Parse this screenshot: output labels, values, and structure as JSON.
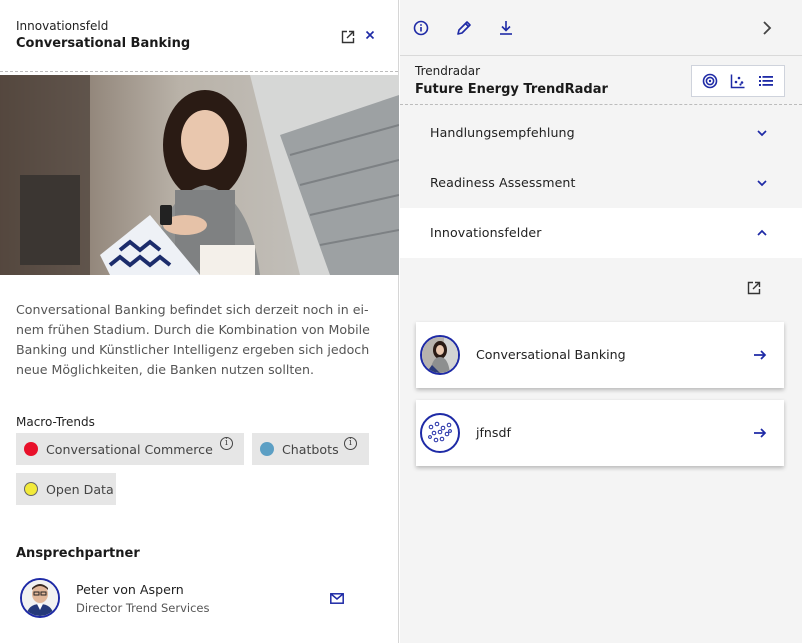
{
  "left_panel": {
    "subtitle": "Innovationsfeld",
    "title": "Conversational Banking",
    "description": "Conversational Banking befindet sich derzeit noch in ei-nem frühen Stadium. Durch die Kombination von Mobile Banking und Künstlicher Intelligenz ergeben sich jedoch neue Möglichkeiten, die Banken nutzen sollten.",
    "macro_trends_label": "Macro-Trends",
    "macro_trends": [
      {
        "label": "Conversational Commerce",
        "color": "#e8102a",
        "info": true
      },
      {
        "label": "Chatbots",
        "color": "#5c9fc4",
        "info": true
      },
      {
        "label": "Open Data",
        "color": "#f2ea3a",
        "info": false
      }
    ],
    "contact_heading": "Ansprechpartner",
    "contact": {
      "name": "Peter von Aspern",
      "role": "Director Trend Services"
    }
  },
  "right_panel": {
    "subtitle": "Trendradar",
    "title": "Future Energy TrendRadar",
    "accordion": [
      {
        "label": "Handlungsempfehlung",
        "open": false
      },
      {
        "label": "Readiness Assessment",
        "open": false
      },
      {
        "label": "Innovationsfelder",
        "open": true
      }
    ],
    "items": [
      {
        "label": "Conversational Banking"
      },
      {
        "label": "jfnsdf"
      }
    ]
  },
  "colors": {
    "accent": "#1e2aa6",
    "chip_bg": "#e6e6e6",
    "panel_bg": "#f4f4f4"
  }
}
